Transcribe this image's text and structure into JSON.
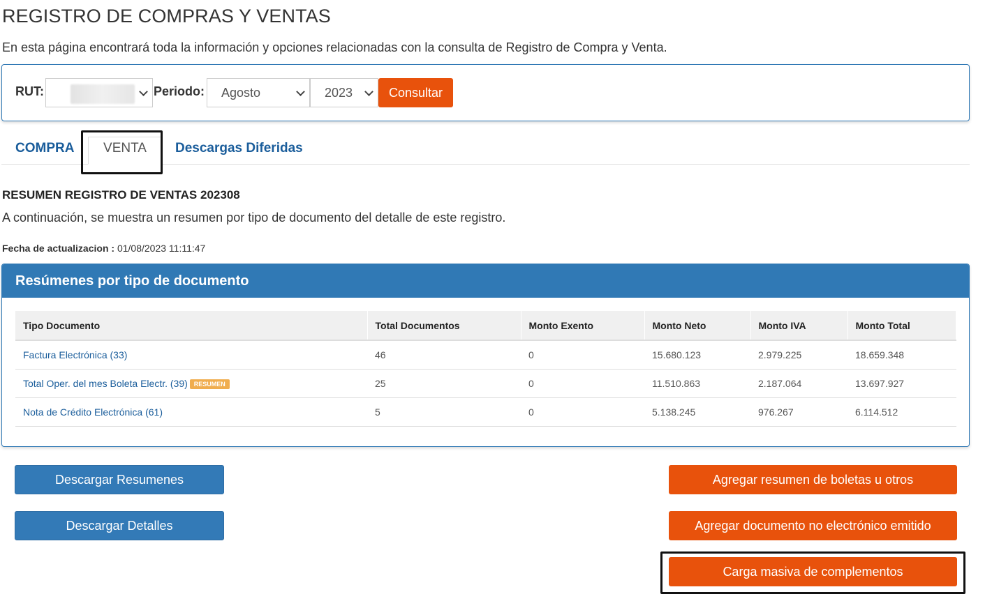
{
  "header": {
    "title": "REGISTRO DE COMPRAS Y VENTAS",
    "description": "En esta página encontrará toda la información y opciones relacionadas con la consulta de Registro de Compra y Venta."
  },
  "filters": {
    "rut_label": "RUT:",
    "periodo_label": "Periodo:",
    "month_value": "Agosto",
    "year_value": "2023",
    "consultar_label": "Consultar"
  },
  "tabs": [
    {
      "label": "COMPRA",
      "active": false
    },
    {
      "label": "VENTA",
      "active": true
    },
    {
      "label": "Descargas Diferidas",
      "active": false
    }
  ],
  "summary": {
    "title": "RESUMEN REGISTRO DE VENTAS 202308",
    "description": "A continuación, se muestra un resumen por tipo de documento del detalle de este registro.",
    "update_label": "Fecha de actualizacion :",
    "update_value": "01/08/2023 11:11:47"
  },
  "panel": {
    "title": "Resúmenes por tipo de documento",
    "columns": [
      "Tipo Documento",
      "Total Documentos",
      "Monto Exento",
      "Monto Neto",
      "Monto IVA",
      "Monto Total"
    ],
    "rows": [
      {
        "tipo": "Factura Electrónica (33)",
        "badge": "",
        "total": "46",
        "exento": "0",
        "neto": "15.680.123",
        "iva": "2.979.225",
        "monto_total": "18.659.348"
      },
      {
        "tipo": "Total Oper. del mes Boleta Electr. (39)",
        "badge": "RESUMEN",
        "total": "25",
        "exento": "0",
        "neto": "11.510.863",
        "iva": "2.187.064",
        "monto_total": "13.697.927"
      },
      {
        "tipo": "Nota de Crédito Electrónica (61)",
        "badge": "",
        "total": "5",
        "exento": "0",
        "neto": "5.138.245",
        "iva": "976.267",
        "monto_total": "6.114.512"
      }
    ]
  },
  "actions": {
    "descargar_resumenes": "Descargar Resumenes",
    "descargar_detalles": "Descargar Detalles",
    "agregar_resumen": "Agregar resumen de boletas u otros",
    "agregar_documento": "Agregar documento no electrónico emitido",
    "carga_masiva": "Carga masiva de complementos"
  },
  "colors": {
    "primary_blue": "#3079b5",
    "accent_orange": "#e8520c",
    "badge_orange": "#f0ad4e",
    "link_blue": "#1a5d9b"
  },
  "icons": [
    "chevron-down-icon"
  ]
}
